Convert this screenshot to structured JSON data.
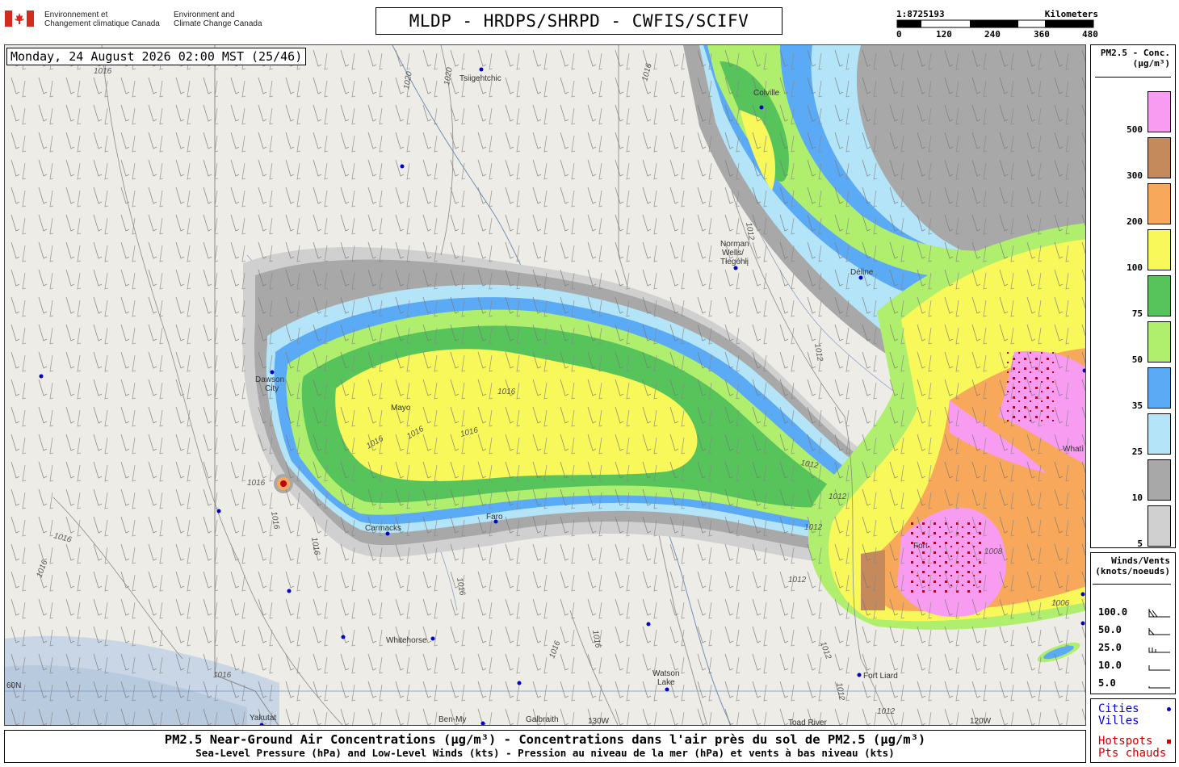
{
  "header": {
    "dept_fr_line1": "Environnement et",
    "dept_fr_line2": "Changement climatique Canada",
    "dept_en_line1": "Environment and",
    "dept_en_line2": "Climate Change Canada",
    "title": "MLDP - HRDPS/SHRPD - CWFIS/SCIFV",
    "scale_ratio": "1:8725193",
    "scale_unit": "Kilometers",
    "scale_ticks": [
      "0",
      "120",
      "240",
      "360",
      "480"
    ]
  },
  "timestamp": "Monday, 24 August 2026 02:00 MST (25/46)",
  "legend_pm": {
    "title_line1": "PM2.5 - Conc.",
    "title_line2": "(μg/m³)",
    "entries": [
      {
        "label": "500",
        "color": "#f79cf0"
      },
      {
        "label": "300",
        "color": "#c48a5c"
      },
      {
        "label": "200",
        "color": "#f8a85a"
      },
      {
        "label": "100",
        "color": "#f8f85a"
      },
      {
        "label": "75",
        "color": "#56c45a"
      },
      {
        "label": "50",
        "color": "#b0ee6e"
      },
      {
        "label": "35",
        "color": "#5aaaf6"
      },
      {
        "label": "25",
        "color": "#b4e4f8"
      },
      {
        "label": "10",
        "color": "#a8a8a8"
      },
      {
        "label": "5",
        "color": "#d0d0d0"
      }
    ]
  },
  "legend_wind": {
    "title_line1": "Winds/Vents",
    "title_line2": "(knots/noeuds)",
    "entries": [
      "100.0",
      "50.0",
      "25.0",
      "10.0",
      "5.0"
    ]
  },
  "legend_cities": {
    "cities_line1": "Cities",
    "cities_line2": "Villes",
    "hotspots_line1": "Hotspots",
    "hotspots_line2": "Pts chauds",
    "cities_color": "#0000cc",
    "hotspots_color": "#cc0000"
  },
  "footer": {
    "line1": "PM2.5 Near-Ground Air Concentrations (μg/m³) - Concentrations dans l'air près du sol de PM2.5 (μg/m³)",
    "line2": "Sea-Level Pressure (hPa) and Low-Level Winds (kts) - Pression au niveau de la mer (hPa) et vents à bas niveau (kts)"
  },
  "map": {
    "places": {
      "tsiigehtchic": "Tsiigehtchic",
      "colville": "Colville",
      "norman_wells_1": "Norman",
      "norman_wells_2": "Wells/",
      "norman_wells_3": "Tłegóhłį",
      "deline": "Déline",
      "dawson_1": "Dawson",
      "dawson_2": "City",
      "mayo": "Mayo",
      "carmacks": "Carmacks",
      "faro": "Faro",
      "whitehorse": "Whitehorse",
      "watson_1": "Watson",
      "watson_2": "Lake",
      "fort_liard": "Fort Liard",
      "yakutat": "Yakutat",
      "ben_my": "Ben-My",
      "galbraith": "Galbraith",
      "toad_river": "Toad River",
      "whati": "Whatì",
      "fort_good": "Fort",
      "lon_130": "130W",
      "lon_120": "120W",
      "lat_60": "60N"
    },
    "isobars": [
      "1016",
      "1020",
      "1012",
      "1008",
      "1006"
    ]
  }
}
